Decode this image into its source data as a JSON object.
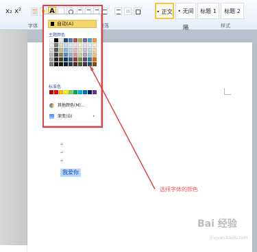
{
  "ribbon": {
    "font_effects": "x₂ x²",
    "font_color": "A",
    "group_labels": {
      "font": "字体",
      "paragraph": "段落",
      "styles": "样式"
    },
    "styles": [
      "• 正文",
      "• 无间隔",
      "标题 1",
      "标题 2"
    ]
  },
  "document": {
    "selected_text": "我爱你"
  },
  "color_menu": {
    "automatic_label": "自动(A)",
    "theme_colors_label": "主题颜色",
    "standard_colors_label": "标准色",
    "more_colors_label": "其他颜色(M)...",
    "gradient_label": "渐变(G)",
    "theme_colors": [
      [
        "#ffffff",
        "#000000",
        "#eeece1",
        "#1f497d",
        "#4f81bd",
        "#c0504d",
        "#9bbb59",
        "#8064a2",
        "#4bacc6",
        "#f79646"
      ],
      [
        "#f2f2f2",
        "#7f7f7f",
        "#ddd9c3",
        "#c6d9f0",
        "#dbe5f1",
        "#f2dcdb",
        "#ebf1dd",
        "#e5e0ec",
        "#dbeef3",
        "#fdeada"
      ],
      [
        "#d8d8d8",
        "#595959",
        "#c4bd97",
        "#8db3e2",
        "#b8cce4",
        "#e5b9b7",
        "#d7e3bc",
        "#ccc1d9",
        "#b7dde8",
        "#fbd5b5"
      ],
      [
        "#bfbfbf",
        "#3f3f3f",
        "#938953",
        "#548dd4",
        "#95b3d7",
        "#d99694",
        "#c3d69b",
        "#b2a2c7",
        "#92cddc",
        "#fac08f"
      ],
      [
        "#a5a5a5",
        "#262626",
        "#494429",
        "#17365d",
        "#366092",
        "#953734",
        "#76923c",
        "#5f497a",
        "#31859b",
        "#e36c09"
      ],
      [
        "#7f7f7f",
        "#0c0c0c",
        "#1d1b10",
        "#0f243e",
        "#244061",
        "#632423",
        "#4f6128",
        "#3f3151",
        "#205867",
        "#974806"
      ]
    ],
    "standard_colors": [
      "#c00000",
      "#ff0000",
      "#ffc000",
      "#ffff00",
      "#92d050",
      "#00b050",
      "#00b0f0",
      "#0070c0",
      "#002060",
      "#7030a0"
    ]
  },
  "annotation": {
    "text": "选择字体的颜色"
  },
  "watermark": {
    "main": "Bai 经验",
    "sub": "jingyan.baidu.com"
  },
  "colors": {
    "highlight": "#e34141",
    "selection": "#b9d7ff"
  }
}
